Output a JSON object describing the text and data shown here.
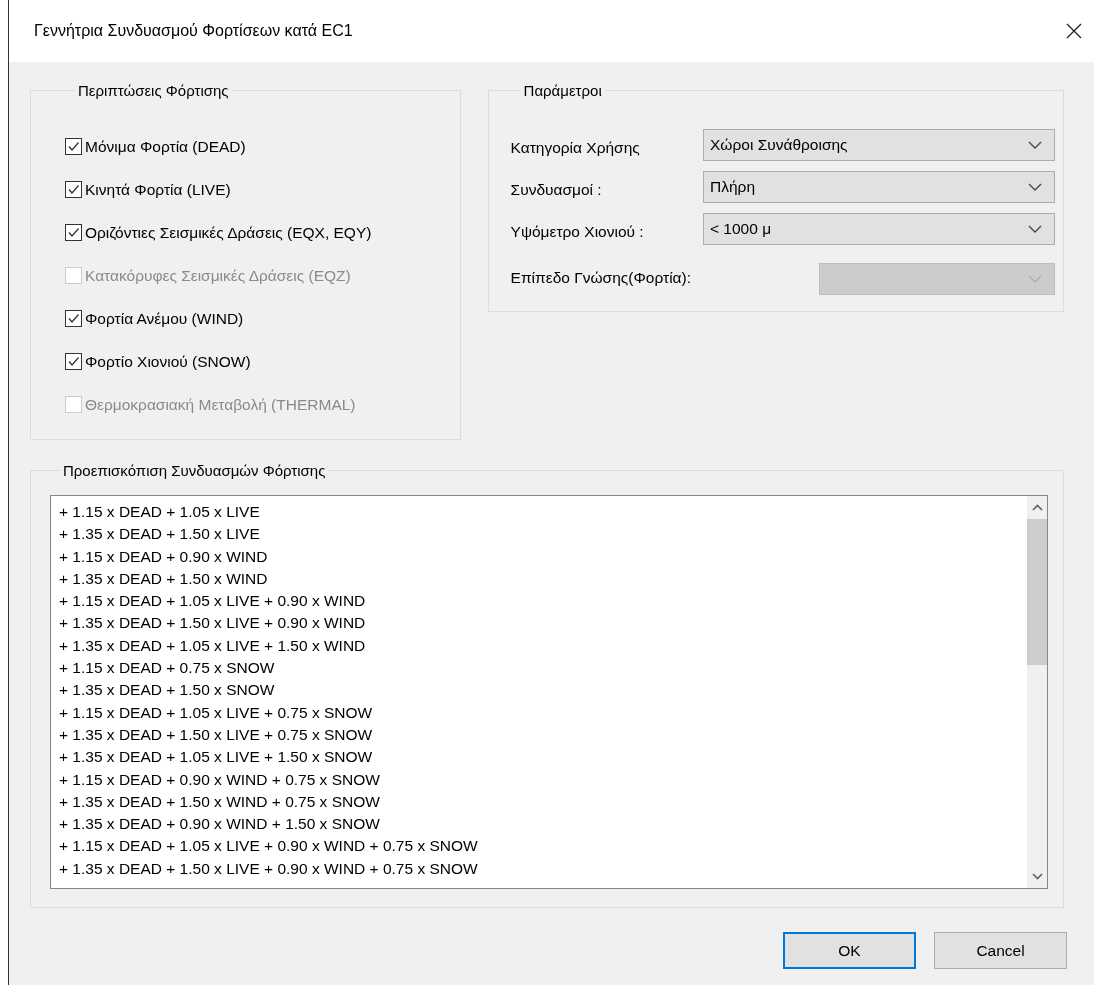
{
  "window": {
    "title": "Γεννήτρια Συνδυασμού Φορτίσεων κατά EC1"
  },
  "load_cases": {
    "title": "Περιπτώσεις Φόρτισης",
    "items": [
      {
        "label": "Μόνιμα Φορτία (DEAD)",
        "checked": true,
        "disabled": false
      },
      {
        "label": "Κινητά Φορτία (LIVE)",
        "checked": true,
        "disabled": false
      },
      {
        "label": "Οριζόντιες Σεισμικές Δράσεις (EQX, EQY)",
        "checked": true,
        "disabled": false
      },
      {
        "label": "Κατακόρυφες Σεισμικές Δράσεις (EQZ)",
        "checked": false,
        "disabled": true
      },
      {
        "label": "Φορτία Ανέμου (WIND)",
        "checked": true,
        "disabled": false
      },
      {
        "label": "Φορτίο Χιονιού (SNOW)",
        "checked": true,
        "disabled": false
      },
      {
        "label": "Θερμοκρασιακή Μεταβολή (THERMAL)",
        "checked": false,
        "disabled": true
      }
    ]
  },
  "parameters": {
    "title": "Παράμετροι",
    "fields": [
      {
        "label": "Κατηγορία Χρήσης",
        "value": "Χώροι Συνάθροισης",
        "disabled": false
      },
      {
        "label": "Συνδυασμοί :",
        "value": "Πλήρη",
        "disabled": false
      },
      {
        "label": "Υψόμετρο Χιονιού :",
        "value": "< 1000 μ",
        "disabled": false
      },
      {
        "label": "Επίπεδο Γνώσης(Φορτία):",
        "disabled": true
      }
    ]
  },
  "preview": {
    "title": "Προεπισκόπιση Συνδυασμών Φόρτισης",
    "rows": [
      "+ 1.15 x DEAD + 1.05 x LIVE",
      "+ 1.35 x DEAD + 1.50 x LIVE",
      "+ 1.15 x DEAD + 0.90 x WIND",
      "+ 1.35 x DEAD + 1.50 x WIND",
      "+ 1.15 x DEAD + 1.05 x LIVE + 0.90 x WIND",
      "+ 1.35 x DEAD + 1.50 x LIVE + 0.90 x WIND",
      "+ 1.35 x DEAD + 1.05 x LIVE + 1.50 x WIND",
      "+ 1.15 x DEAD + 0.75 x SNOW",
      "+ 1.35 x DEAD + 1.50 x SNOW",
      "+ 1.15 x DEAD + 1.05 x LIVE + 0.75 x SNOW",
      "+ 1.35 x DEAD + 1.50 x LIVE + 0.75 x SNOW",
      "+ 1.35 x DEAD + 1.05 x LIVE + 1.50 x SNOW",
      "+ 1.15 x DEAD + 0.90 x WIND + 0.75 x SNOW",
      "+ 1.35 x DEAD + 1.50 x WIND + 0.75 x SNOW",
      "+ 1.35 x DEAD + 0.90 x WIND + 1.50 x SNOW",
      "+ 1.15 x DEAD + 1.05 x LIVE + 0.90 x WIND + 0.75 x SNOW",
      "+ 1.35 x DEAD + 1.50 x LIVE + 0.90 x WIND + 0.75 x SNOW"
    ]
  },
  "buttons": [
    {
      "label": "OK",
      "default": true
    },
    {
      "label": "Cancel",
      "default": false
    }
  ]
}
